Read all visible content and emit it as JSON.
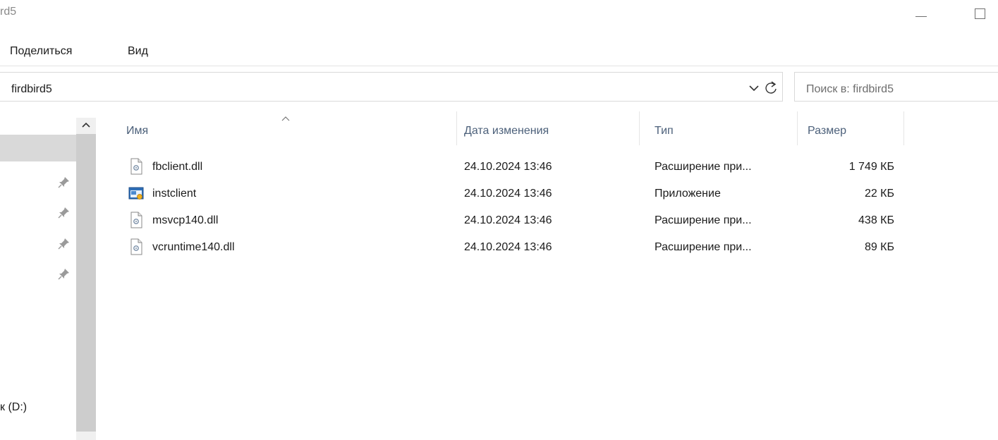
{
  "window": {
    "title": "rd5",
    "minimize_icon": "minimize-icon",
    "maximize_icon": "maximize-icon"
  },
  "menu": {
    "share_label": "Поделиться",
    "view_label": "Вид"
  },
  "address": {
    "path": "firdbird5",
    "dropdown_icon": "chevron-down-icon",
    "refresh_icon": "refresh-icon"
  },
  "search": {
    "placeholder": "Поиск в: firdbird5"
  },
  "nav": {
    "pin_icon": "pin-icon",
    "drive_label": "к (D:)"
  },
  "columns": {
    "name": "Имя",
    "date": "Дата изменения",
    "type": "Тип",
    "size": "Размер",
    "sort_icon": "sort-ascending-icon"
  },
  "files": [
    {
      "name": "fbclient.dll",
      "date": "24.10.2024 13:46",
      "type": "Расширение при...",
      "size": "1 749 КБ",
      "icon": "dll-file-icon"
    },
    {
      "name": "instclient",
      "date": "24.10.2024 13:46",
      "type": "Приложение",
      "size": "22 КБ",
      "icon": "application-icon"
    },
    {
      "name": "msvcp140.dll",
      "date": "24.10.2024 13:46",
      "type": "Расширение при...",
      "size": "438 КБ",
      "icon": "dll-file-icon"
    },
    {
      "name": "vcruntime140.dll",
      "date": "24.10.2024 13:46",
      "type": "Расширение при...",
      "size": "89 КБ",
      "icon": "dll-file-icon"
    }
  ],
  "colors": {
    "header_text": "#4c607a",
    "scroll_thumb": "#cdcdcd",
    "selection": "#d9d9d9"
  }
}
